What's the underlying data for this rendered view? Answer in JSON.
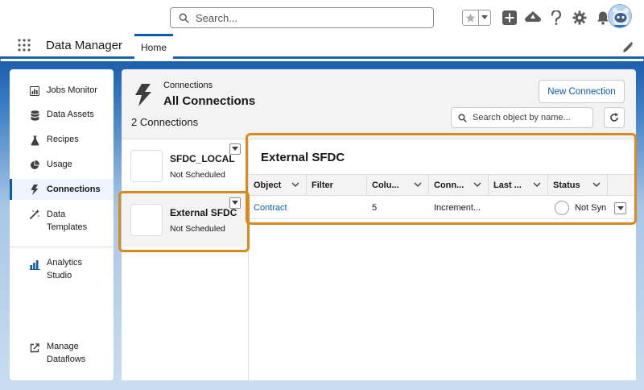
{
  "global_header": {
    "search_placeholder": "Search..."
  },
  "app_bar": {
    "app_name": "Data Manager",
    "tab_home": "Home"
  },
  "sidebar": {
    "items": [
      {
        "label": "Jobs Monitor",
        "icon": "jobs-monitor-icon"
      },
      {
        "label": "Data Assets",
        "icon": "database-icon"
      },
      {
        "label": "Recipes",
        "icon": "flask-icon"
      },
      {
        "label": "Usage",
        "icon": "pie-chart-icon"
      },
      {
        "label": "Connections",
        "icon": "lightning-icon",
        "active": true
      },
      {
        "label": "Data Templates",
        "icon": "magic-wand-icon"
      },
      {
        "label": "Analytics Studio",
        "icon": "bar-chart-icon"
      },
      {
        "label": "Manage Dataflows",
        "icon": "external-link-icon"
      }
    ]
  },
  "main": {
    "eyebrow": "Connections",
    "title": "All Connections",
    "count": "2 Connections",
    "new_connection_label": "New Connection",
    "object_search_placeholder": "Search object by name..."
  },
  "connections": [
    {
      "name": "SFDC_LOCAL",
      "status": "Not Scheduled"
    },
    {
      "name": "External SFDC",
      "status": "Not Scheduled"
    }
  ],
  "detail": {
    "title": "External SFDC",
    "columns": [
      "Object",
      "Filter",
      "Colu...",
      "Conn...",
      "Last ...",
      "Status"
    ],
    "rows": [
      {
        "object": "Contract",
        "filter": "",
        "columns": "5",
        "connection_mode": "Increment...",
        "last_run": "",
        "status": "Not Syn"
      }
    ]
  },
  "colors": {
    "brand_blue": "#1b5fae",
    "link_blue": "#0b5cab",
    "highlight_orange": "#d98a1f"
  }
}
